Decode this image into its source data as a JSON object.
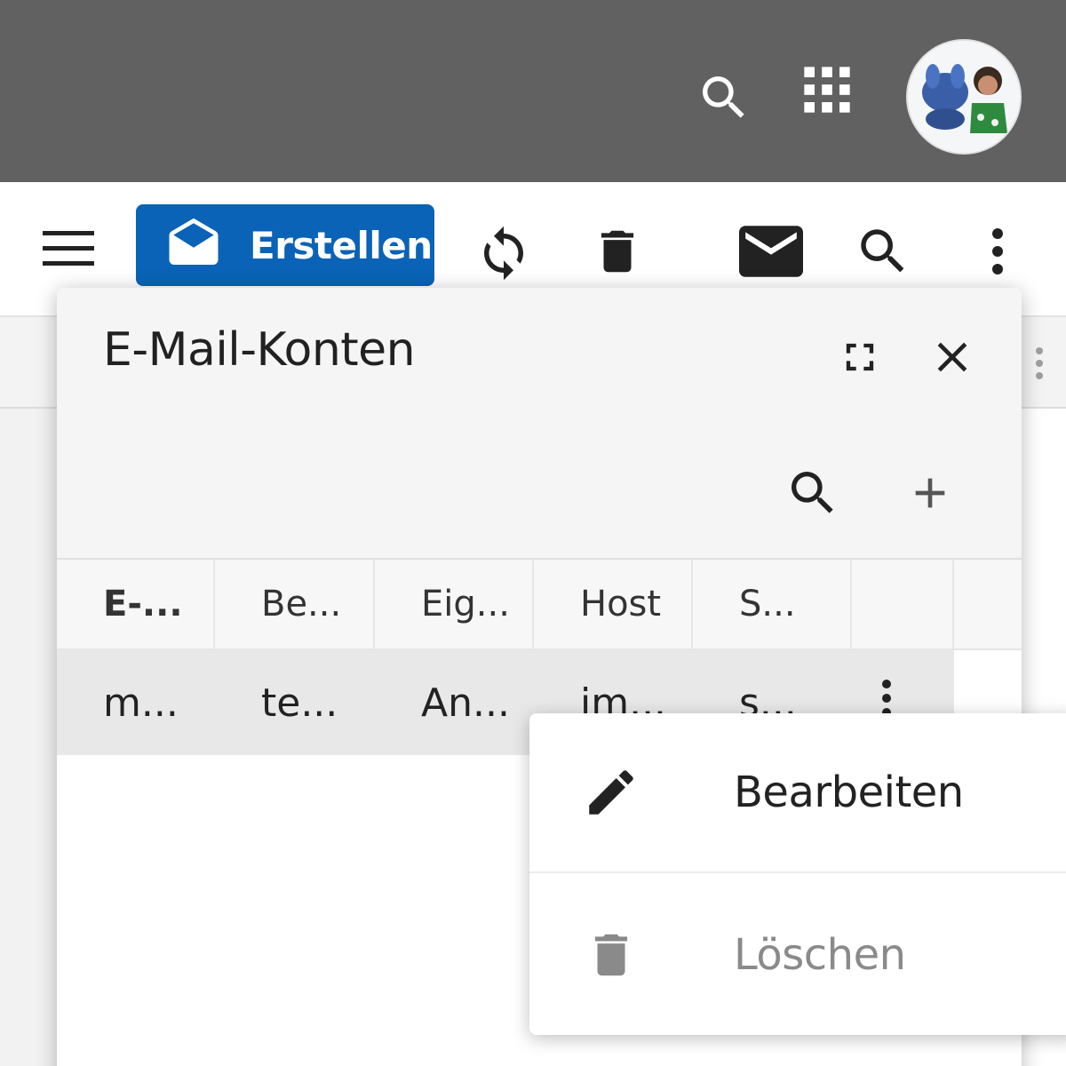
{
  "topbar": {
    "background": "#616161",
    "search_icon": "search-icon",
    "apps_icon": "apps-grid-icon",
    "avatar_icon": "user-avatar"
  },
  "toolbar": {
    "menu_icon": "hamburger-menu-icon",
    "create_label": "Erstellen",
    "create_icon": "open-envelope-icon",
    "accent": "#0a63b6",
    "icons": [
      "refresh-icon",
      "trash-icon",
      "envelope-icon",
      "search-icon",
      "more-vertical-icon"
    ]
  },
  "dialog": {
    "title": "E-Mail-Konten",
    "header_icons": [
      "fullscreen-icon",
      "close-icon"
    ],
    "tool_icons": [
      "search-icon",
      "plus-icon"
    ],
    "table": {
      "columns": [
        "E-...",
        "Be...",
        "Eig...",
        "Host",
        "S..."
      ],
      "rows": [
        [
          "m...",
          "te...",
          "An...",
          "im...",
          "s..."
        ]
      ]
    }
  },
  "context_menu": {
    "items": [
      {
        "label": "Bearbeiten",
        "icon": "pencil-icon",
        "enabled": true
      },
      {
        "label": "Löschen",
        "icon": "trash-icon",
        "enabled": false
      }
    ]
  }
}
